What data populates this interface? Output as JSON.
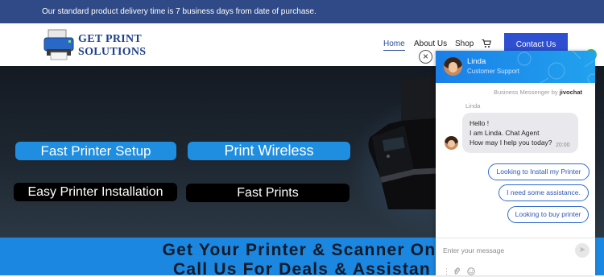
{
  "topbar": {
    "notice": "Our standard product delivery time is 7 business days from date of purchase."
  },
  "logo": {
    "line1": "GET PRINT",
    "line2": "SOLUTIONS"
  },
  "nav": {
    "home": "Home",
    "about": "About Us",
    "shop": "Shop",
    "contact": "Contact Us",
    "cart_icon": "cart-icon"
  },
  "hero": {
    "pill1": "Fast Printer Setup",
    "pill2": "Print Wireless",
    "pill3": "Easy Printer Installation",
    "pill4": "Fast Prints"
  },
  "band": {
    "line1": "Get Your Printer & Scanner Onl",
    "line2": "Call Us For Deals & Assistan"
  },
  "chat": {
    "agent_name": "Linda",
    "agent_role": "Customer Support",
    "powered_prefix": "Business Messenger by",
    "powered_brand": "jivochat",
    "msg_sender": "Linda",
    "msg_line1": "Hello !",
    "msg_line2": "I am Linda. Chat Agent",
    "msg_line3": "How may I help you today?",
    "msg_time": "20:00",
    "reply1": "Looking to Install my Printer",
    "reply2": "I need some assistance.",
    "reply3": "Looking to buy printer",
    "input_placeholder": "Enter your message",
    "close_symbol": "×",
    "send_symbol": "➤"
  },
  "colors": {
    "topbar": "#2f4a86",
    "accent": "#2e4fd0",
    "hero_pill_blue": "#1f8de0",
    "band": "#1b87e0",
    "chat_header": "#1a7fe8"
  }
}
